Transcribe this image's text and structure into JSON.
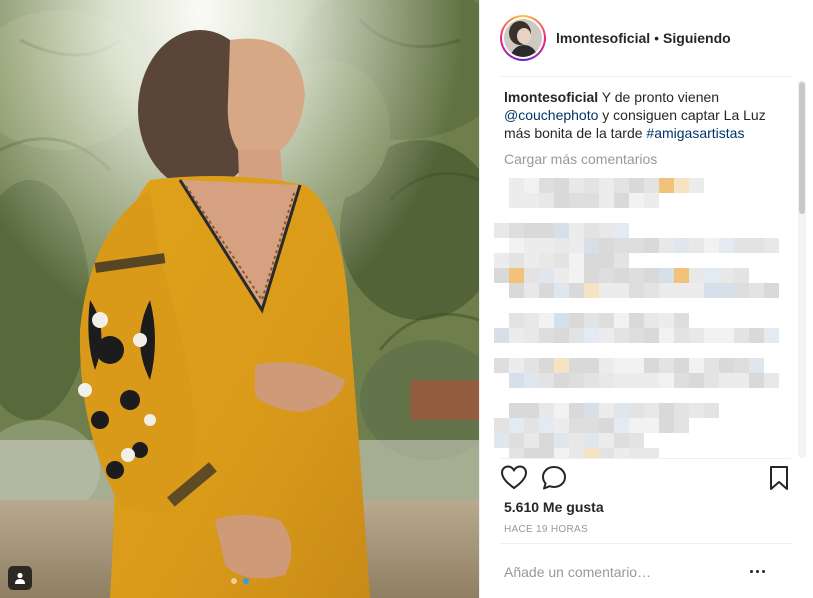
{
  "post": {
    "username": "lmontesoficial",
    "separator": "•",
    "follow_status": "Siguiendo",
    "caption": {
      "username": "lmontesoficial",
      "text_1": " Y de pronto vienen ",
      "mention": "@couchephoto",
      "text_2": " y consiguen captar La Luz más bonita de la tarde ",
      "hashtag": "#amigasartistas"
    },
    "load_more_comments": "Cargar más comentarios",
    "likes": "5.610 Me gusta",
    "time_ago": "HACE 19 HORAS",
    "add_comment_placeholder": "Añade un comentario…"
  },
  "carousel": {
    "slides": 2,
    "active_slide": 2
  },
  "icons": {
    "like": "heart-icon",
    "comment": "comment-icon",
    "save": "bookmark-icon",
    "more": "more-options-icon",
    "tags": "user-tag-icon"
  },
  "colors": {
    "link": "#003569",
    "text": "#262626",
    "muted": "#999999",
    "carousel_active": "#3897f0"
  }
}
